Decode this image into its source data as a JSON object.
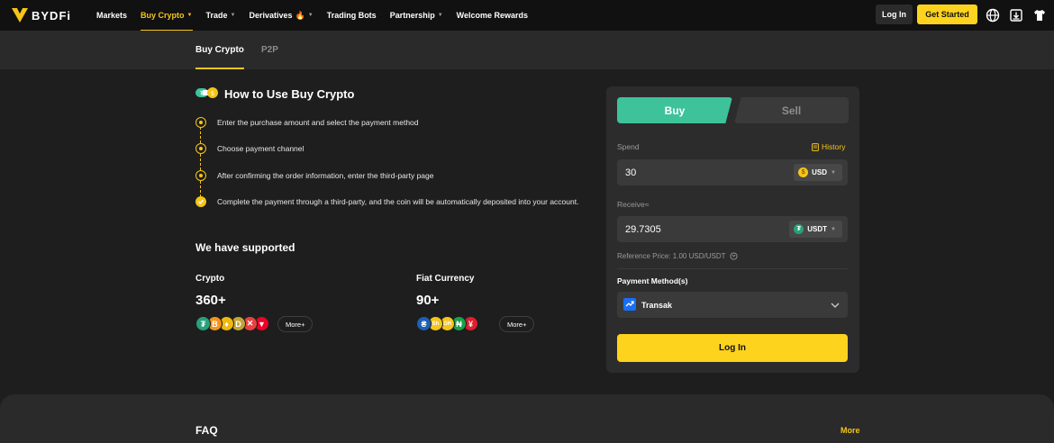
{
  "nav": {
    "logo_text": "BYDFi",
    "items": [
      {
        "label": "Markets",
        "caret": false,
        "active": false
      },
      {
        "label": "Buy Crypto",
        "caret": true,
        "active": true
      },
      {
        "label": "Trade",
        "caret": true,
        "active": false
      },
      {
        "label": "Derivatives",
        "caret": true,
        "active": false,
        "fire": true
      },
      {
        "label": "Trading Bots",
        "caret": false,
        "active": false
      },
      {
        "label": "Partnership",
        "caret": true,
        "active": false
      },
      {
        "label": "Welcome Rewards",
        "caret": false,
        "active": false
      }
    ],
    "login_label": "Log In",
    "get_started_label": "Get Started",
    "icons": [
      "globe-icon",
      "download-icon",
      "shirt-icon"
    ]
  },
  "subtabs": {
    "buy_crypto": "Buy Crypto",
    "p2p": "P2P"
  },
  "how_to": {
    "title": "How to Use Buy Crypto",
    "steps": [
      "Enter the purchase amount and select the payment method",
      "Choose payment channel",
      "After confirming the order information, enter the third-party page",
      "Complete the payment through a third-party, and the coin will be automatically deposited into your account."
    ]
  },
  "supported": {
    "title": "We have supported",
    "crypto": {
      "label": "Crypto",
      "count": "360+",
      "more": "More+",
      "coins": [
        {
          "glyph": "₮",
          "color": "#26a17b"
        },
        {
          "glyph": "B",
          "color": "#f7931a"
        },
        {
          "glyph": "♦",
          "color": "#f0b90b"
        },
        {
          "glyph": "D",
          "color": "#c2a633"
        },
        {
          "glyph": "✕",
          "color": "#e84142"
        },
        {
          "glyph": "▼",
          "color": "#ef0027"
        }
      ]
    },
    "fiat": {
      "label": "Fiat Currency",
      "count": "90+",
      "more": "More+",
      "coins": [
        {
          "glyph": "₴",
          "color": "#1d5fb5"
        },
        {
          "glyph": "Sh",
          "color": "#f5c518"
        },
        {
          "glyph": "GH",
          "color": "#f5c518"
        },
        {
          "glyph": "₦",
          "color": "#16a34a"
        },
        {
          "glyph": "¥",
          "color": "#e11d2e"
        }
      ]
    }
  },
  "trade_card": {
    "buy_label": "Buy",
    "sell_label": "Sell",
    "spend_label": "Spend",
    "history_label": "History",
    "spend_value": "30",
    "spend_currency": "USD",
    "receive_label": "Receive≈",
    "receive_value": "29.7305",
    "receive_currency": "USDT",
    "reference_price": "Reference Price: 1.00 USD/USDT",
    "payment_method_label": "Payment Method(s)",
    "payment_method": "Transak",
    "login_label": "Log In"
  },
  "faq": {
    "title": "FAQ",
    "more": "More"
  },
  "colors": {
    "accent": "#fdd31d",
    "buy": "#3ec29a",
    "background": "#1e1e1e"
  }
}
